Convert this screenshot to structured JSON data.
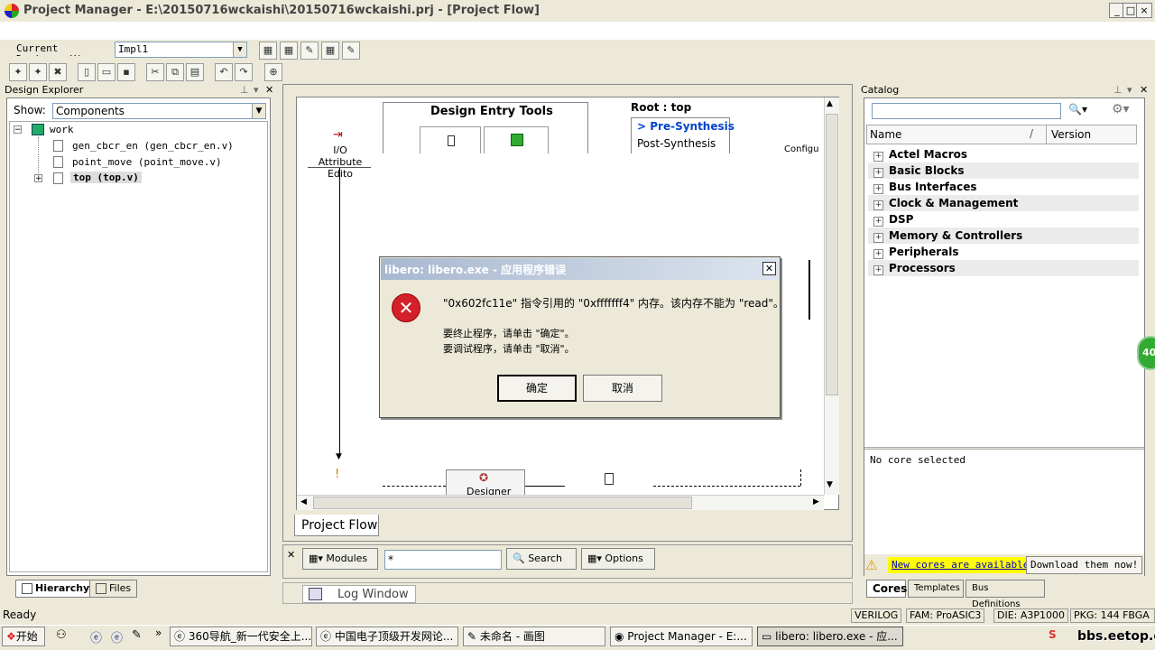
{
  "window": {
    "title": "Project Manager - E:\\20150716wckaishi\\20150716wckaishi.prj - [Project Flow]",
    "min_label": "_",
    "max_label": "□",
    "close_label": "×"
  },
  "toolbar": {
    "designer_view_label": "Current Designer View:",
    "designer_view_value": "Impl1"
  },
  "design_explorer": {
    "title": "Design Explorer",
    "show_label": "Show:",
    "show_value": "Components",
    "tree": [
      {
        "label": "work"
      },
      {
        "label": "gen_cbcr_en (gen_cbcr_en.v)"
      },
      {
        "label": "point_move (point_move.v)"
      },
      {
        "label": "top (top.v)"
      }
    ],
    "tabs": [
      "Hierarchy",
      "Files"
    ]
  },
  "flow": {
    "design_entry_title": "Design Entry Tools",
    "root_label": "Root : top",
    "pre_synthesis": "> Pre-Synthesis",
    "post_synthesis": "Post-Synthesis",
    "io_attr": "I/O Attribute Edito",
    "configu": "Configu",
    "designer_label": "Designer",
    "tab_label": "Project Flow"
  },
  "search_bar": {
    "modules_label": "Modules",
    "search_value": "*",
    "search_label": "Search",
    "options_label": "Options"
  },
  "log_window": {
    "label": "Log Window"
  },
  "catalog": {
    "title": "Catalog",
    "col_name": "Name",
    "col_version": "Version",
    "items": [
      "Actel Macros",
      "Basic Blocks",
      "Bus Interfaces",
      "Clock & Management",
      "DSP",
      "Memory & Controllers",
      "Peripherals",
      "Processors"
    ],
    "no_core": "No core selected",
    "new_cores": "New cores are available",
    "download": "Download them now!",
    "tabs": [
      "Cores",
      "Templates",
      "Bus Definitions"
    ]
  },
  "dialog": {
    "title": "libero: libero.exe - 应用程序错误",
    "line1": "\"0x602fc11e\" 指令引用的 \"0xfffffff4\" 内存。该内存不能为 \"read\"。",
    "line2": "要终止程序，请单击 \"确定\"。",
    "line3": "要调试程序，请单击 \"取消\"。",
    "ok_label": "确定",
    "cancel_label": "取消"
  },
  "status": {
    "ready": "Ready",
    "lang": "VERILOG",
    "fam": "FAM: ProASIC3",
    "die": "DIE: A3P1000",
    "pkg": "PKG: 144 FBGA"
  },
  "taskbar": {
    "start": "开始",
    "items": [
      "360导航_新一代安全上...",
      "中国电子顶级开发网论...",
      "未命名 - 画图",
      "Project Manager - E:...",
      "libero: libero.exe - 应..."
    ],
    "watermark": "bbs.eetop.cn",
    "badge": "40"
  },
  "colors": {
    "accent": "#3a6ea5",
    "error_red": "#d4202a",
    "highlight_yellow": "#ffff00",
    "preSynthesis_blue": "#0044cc"
  }
}
